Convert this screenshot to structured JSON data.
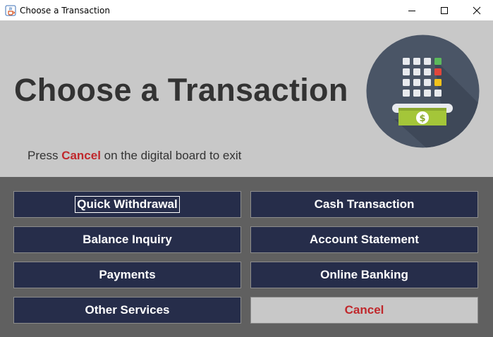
{
  "window": {
    "title": "Choose a Transaction",
    "controls": [
      "minimize-icon",
      "maximize-icon",
      "close-icon"
    ]
  },
  "header": {
    "heading": "Choose a Transaction",
    "hint_before": "Press ",
    "hint_emphasis": "Cancel",
    "hint_after": " on the digital board to exit",
    "logo_icon": "atm-cash-icon",
    "logo_symbol": "$"
  },
  "buttons": {
    "quick_withdrawal": "Quick Withdrawal",
    "cash_transaction": "Cash Transaction",
    "balance_inquiry": "Balance Inquiry",
    "account_statement": "Account Statement",
    "payments": "Payments",
    "online_banking": "Online Banking",
    "other_services": "Other Services",
    "cancel": "Cancel"
  },
  "colors": {
    "header_bg": "#c8c8c8",
    "panel_bg": "#606060",
    "button_bg": "#262d4a",
    "accent_red": "#c0282c",
    "heading_text": "#333333"
  }
}
